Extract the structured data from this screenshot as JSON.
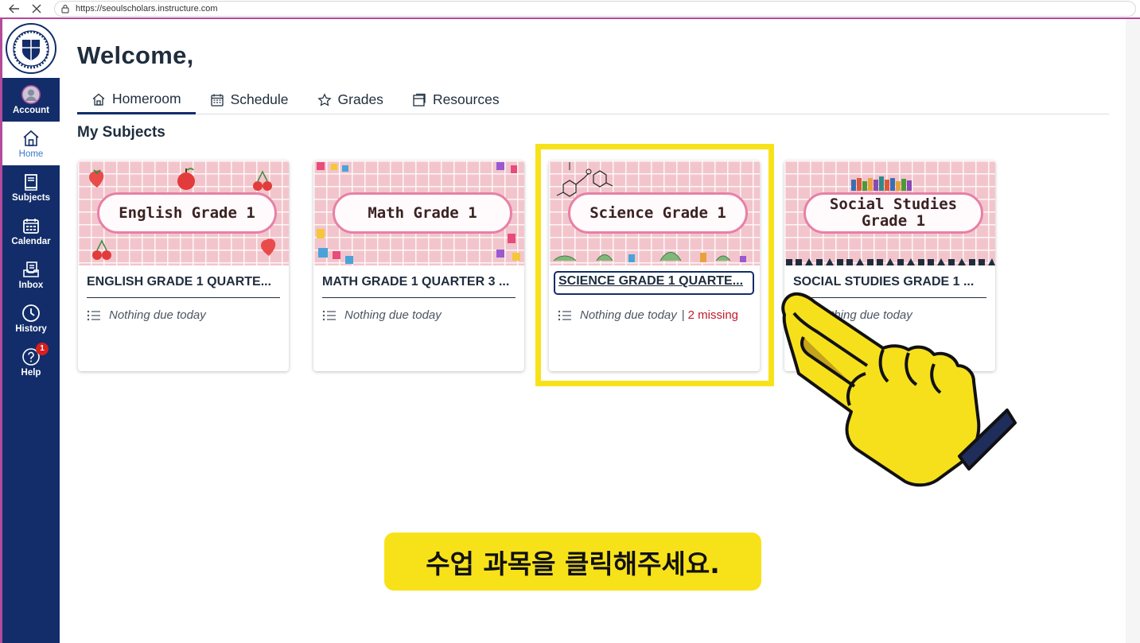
{
  "browser": {
    "url": "https://seoulscholars.instructure.com"
  },
  "nav": {
    "items": [
      {
        "label": "Account",
        "icon": "account-avatar-icon"
      },
      {
        "label": "Home",
        "icon": "home-icon"
      },
      {
        "label": "Subjects",
        "icon": "book-icon"
      },
      {
        "label": "Calendar",
        "icon": "calendar-icon"
      },
      {
        "label": "Inbox",
        "icon": "inbox-icon"
      },
      {
        "label": "History",
        "icon": "clock-icon"
      },
      {
        "label": "Help",
        "icon": "question-icon",
        "badge": "1"
      }
    ]
  },
  "main": {
    "welcome": "Welcome,",
    "tabs": [
      {
        "label": "Homeroom",
        "icon": "home-icon"
      },
      {
        "label": "Schedule",
        "icon": "calendar-grid-icon"
      },
      {
        "label": "Grades",
        "icon": "star-icon"
      },
      {
        "label": "Resources",
        "icon": "document-icon"
      }
    ],
    "section_title": "My Subjects"
  },
  "cards": [
    {
      "hero_title": "English Grade 1",
      "title": "ENGLISH GRADE 1 QUARTE...",
      "status": "Nothing due today"
    },
    {
      "hero_title": "Math Grade 1",
      "title": "MATH GRADE 1 QUARTER 3 ...",
      "status": "Nothing due today"
    },
    {
      "hero_title": "Science Grade 1",
      "title": "SCIENCE GRADE 1 QUARTE...",
      "status": "Nothing due today",
      "separator": "|",
      "missing": "2 missing"
    },
    {
      "hero_title_line1": "Social Studies",
      "hero_title_line2": "Grade 1",
      "title": "SOCIAL STUDIES GRADE 1 ...",
      "status": "Nothing due today"
    }
  ],
  "overlay": {
    "instruction": "수업 과목을 클릭해주세요."
  },
  "colors": {
    "nav_bg": "#122d6a",
    "highlight": "#f7e21a",
    "missing": "#c0192c",
    "hero_pink": "#f2c5cc"
  }
}
